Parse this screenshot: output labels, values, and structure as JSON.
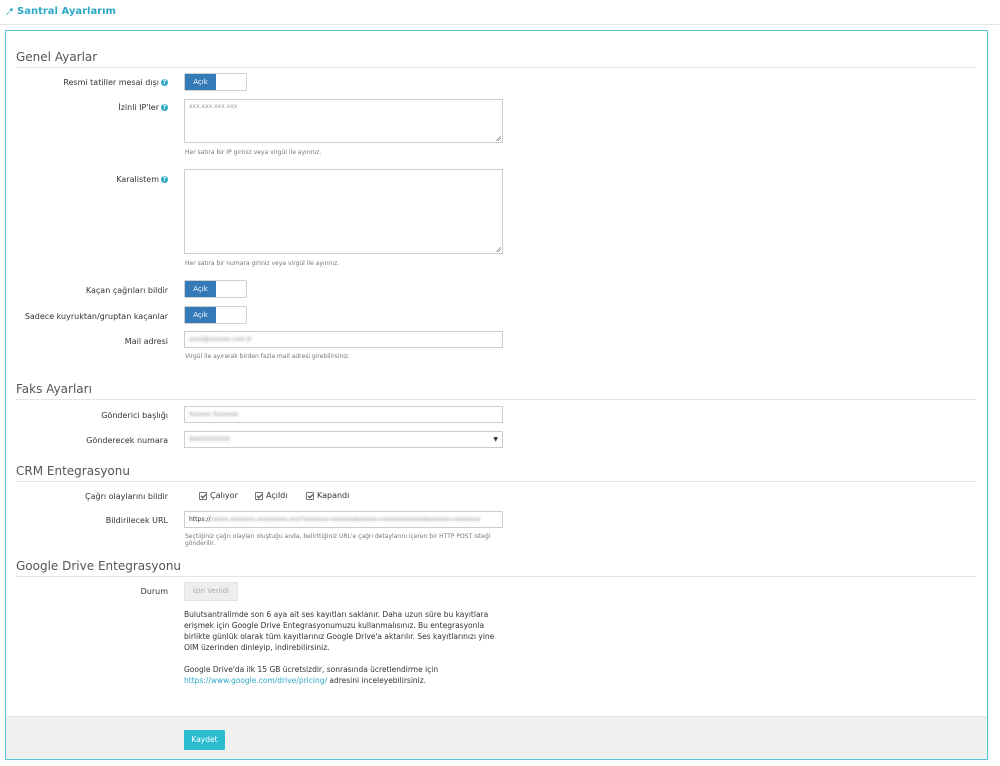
{
  "page": {
    "title": "Santral Ayarlarım"
  },
  "general": {
    "section_title": "Genel Ayarlar",
    "holiday_label": "Resmi tatiller mesai dışı",
    "holiday_toggle": "Açık",
    "ip_label": "İzinli IP'ler",
    "ip_placeholder": "xxx.xxx.xxx.xxx",
    "ip_help": "Her satıra bir IP giriniz veya virgül ile ayırınız.",
    "blacklist_label": "Karalistem",
    "blacklist_help": "Her satıra bir numara giriniz veya virgül ile ayırınız.",
    "missed_label": "Kaçan çağrıları bildir",
    "missed_toggle": "Açık",
    "queue_label": "Sadece kuyruktan/gruptan kaçanlar",
    "queue_toggle": "Açık",
    "mail_label": "Mail adresi",
    "mail_value": "xxxx@xxxxxx.com.tr",
    "mail_help": "Virgül ile ayırarak birden fazla mail adresi girebilirsiniz."
  },
  "fax": {
    "section_title": "Faks Ayarları",
    "sender_label": "Gönderici başlığı",
    "sender_value": "Xxxxxx Xxxxxxx",
    "number_label": "Gönderecek numara",
    "number_value": "9XXXXXXXXX"
  },
  "crm": {
    "section_title": "CRM Entegrasyonu",
    "events_label": "Çağrı olaylarını bildir",
    "events": [
      "Çalıyor",
      "Açıldı",
      "Kapandı"
    ],
    "url_label": "Bildirilecek URL",
    "url_prefix": "https://",
    "url_hidden": "xxxxx.xxxxxxx.xxx/xxxxx.xxx?xxxxxxx=xxxxxx&xxxxx=xxxxxxxxxxxx&xxxxxx=xxxxxxx",
    "url_help": "Seçtiğiniz çağrı olayları oluştuğu anda, belirttiğiniz URL'e çağrı detaylarını içeren bir HTTP POST isteği gönderilir."
  },
  "gdrive": {
    "section_title": "Google Drive Entegrasyonu",
    "status_label": "Durum",
    "status_button": "İzin Verildi",
    "paragraph1": "Bulutsantralimde son 6 aya ait ses kayıtları saklanır. Daha uzun süre bu kayıtlara erişmek için Google Drive Entegrasyonumuzu kullanmalısınız. Bu entegrasyonla birlikte günlük olarak tüm kayıtlarınız Google Drive'a aktarılır. Ses kayıtlarınızı yine OIM üzerinden dinleyip, indirebilirsiniz.",
    "paragraph2_prefix": "Google Drive'da ilk 15 GB ücretsizdir, sonrasında ücretlendirme için",
    "pricing_link": "https://www.google.com/drive/pricing/",
    "paragraph2_suffix": " adresini inceleyebilirsiniz."
  },
  "footer": {
    "save_button": "Kaydet"
  },
  "colors": {
    "accent": "#2ba9c5",
    "toggle_on": "#337ab7",
    "save": "#2bbcd0"
  }
}
